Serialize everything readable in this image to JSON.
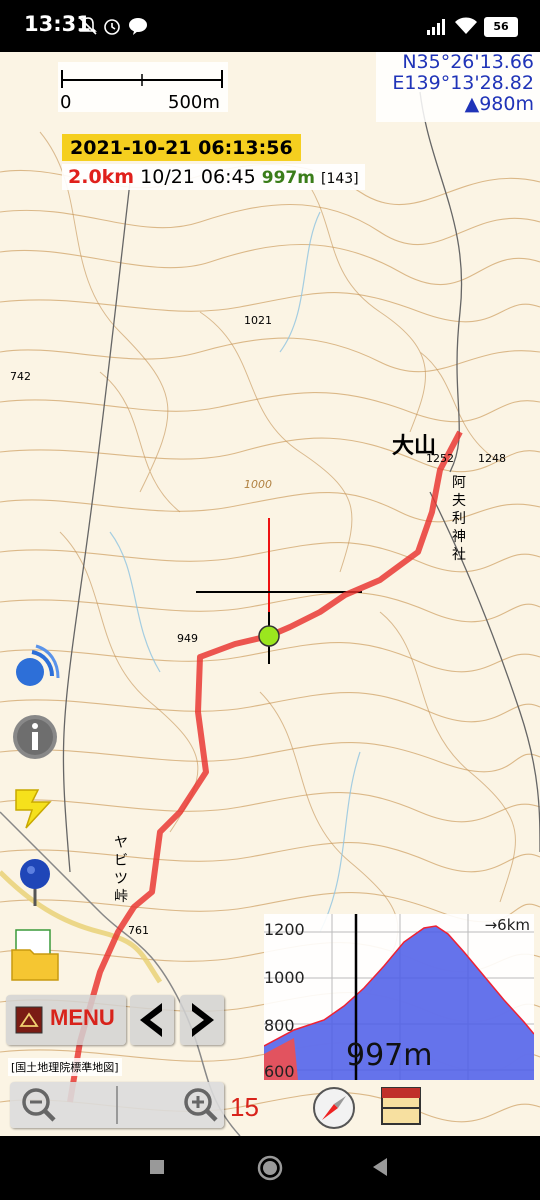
{
  "status_bar": {
    "time": "13:31",
    "icons": [
      "notifications-off-icon",
      "alarm-icon",
      "line-app-icon",
      "signal-icon",
      "wifi-icon"
    ],
    "battery": "56"
  },
  "map": {
    "scale": {
      "left_label": "0",
      "right_label": "500m"
    },
    "coords": {
      "lat": "N35°26'13.66",
      "lon": "E139°13'28.82",
      "altitude": "▲980m"
    },
    "datetime": "2021-10-21 06:13:56",
    "track": {
      "distance": "2.0km",
      "time": "10/21 06:45",
      "altitude": "997m",
      "count": "[143]"
    },
    "labels": {
      "peak": "大山",
      "pass": "ヤビツ峠",
      "shrine": "阿夫利神社",
      "e1021": "1021",
      "e742": "742",
      "e949": "949",
      "e1252": "1252",
      "e1248": "1248",
      "e761": "761",
      "e1000": "1000"
    },
    "source": "[国土地理院標準地図]",
    "colors": {
      "track": "#e8322e",
      "contour": "#c9a067",
      "road": "#555555"
    }
  },
  "controls": {
    "menu_label": "MENU",
    "zoom_level": "15",
    "tool_icons": [
      "gps-signal-icon",
      "info-icon",
      "lightning-icon",
      "pin-icon",
      "folder-icon"
    ]
  },
  "elevation_chart": {
    "distance_label": "→6km",
    "current_altitude": "997m",
    "y_ticks": [
      "1200",
      "1000",
      "800",
      "600"
    ],
    "colors": {
      "profile": "#4a5ae8",
      "track": "#f05050"
    }
  }
}
